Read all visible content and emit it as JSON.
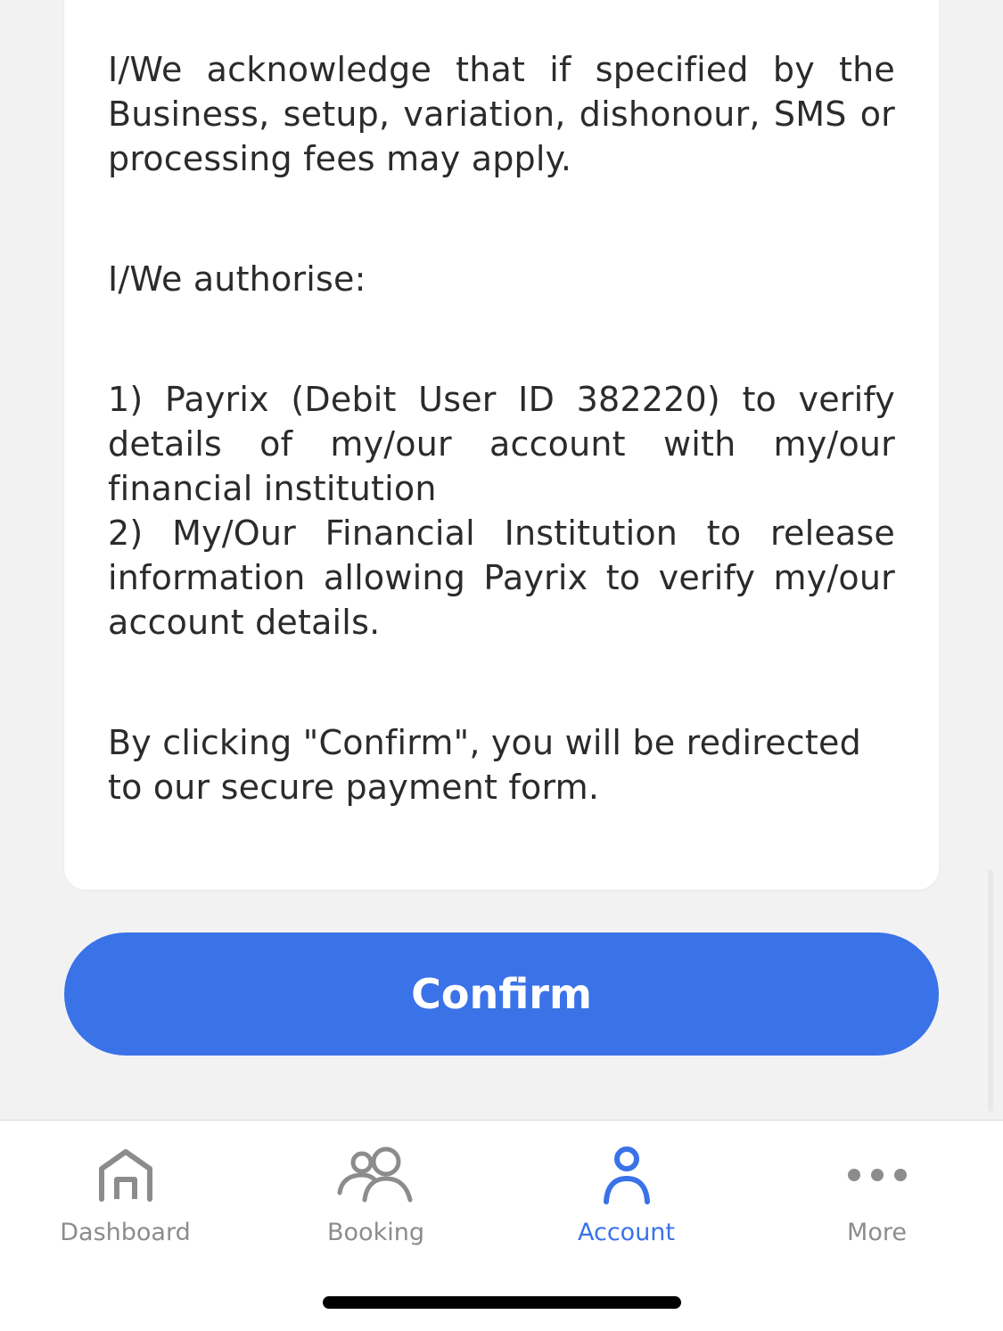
{
  "content": {
    "paragraph_fees": "I/We acknowledge that if specified by the Business, setup, variation, dishonour, SMS or processing fees may apply.",
    "authorise_heading": "I/We authorise:",
    "authorise_item_1": "1) Payrix (Debit User ID 382220) to verify details of my/our account with my/our financial institution",
    "authorise_item_2": "2) My/Our Financial Institution to release information allowing Payrix to verify my/our account details.",
    "redirect_notice": "By clicking \"Confirm\", you will be redirected to our secure payment form."
  },
  "confirm_button": {
    "label": "Confirm"
  },
  "tabbar": {
    "active": "Account",
    "items": [
      {
        "label": "Dashboard",
        "icon": "home-icon"
      },
      {
        "label": "Booking",
        "icon": "people-icon"
      },
      {
        "label": "Account",
        "icon": "person-icon"
      },
      {
        "label": "More",
        "icon": "more-dots-icon"
      }
    ]
  },
  "colors": {
    "accent": "#3a72e8",
    "background": "#f2f2f2",
    "card": "#ffffff",
    "text": "#2b2b2b",
    "tab_inactive": "#8c8c8c"
  }
}
